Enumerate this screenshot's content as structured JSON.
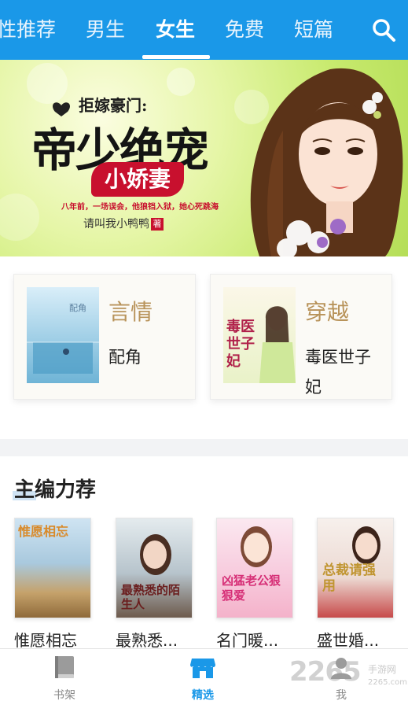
{
  "top_tabs": [
    {
      "label": "性推荐"
    },
    {
      "label": "男生"
    },
    {
      "label": "女生"
    },
    {
      "label": "免费"
    },
    {
      "label": "短篇"
    }
  ],
  "active_tab": "女生",
  "banner": {
    "subtitle": "拒嫁豪门:",
    "title": "帝少绝宠",
    "badge": "小娇妻",
    "tagline": "八年前，一场误会，他狼铛入狱，她心死跳海",
    "author": "请叫我小鸭鸭",
    "author_seal": "著"
  },
  "categories": [
    {
      "category": "言情",
      "book": "配角",
      "cover_text": "配角"
    },
    {
      "category": "穿越",
      "book": "毒医世子妃",
      "cover_text": "毒医世子妃"
    }
  ],
  "picks": {
    "heading": "主编力荐",
    "books": [
      {
        "name": "惟愿相忘",
        "cover_text": "惟愿相忘"
      },
      {
        "name": "最熟悉...",
        "cover_text": "最熟悉的陌生人"
      },
      {
        "name": "名门暖...",
        "cover_text": "凶猛老公狠狠爱"
      },
      {
        "name": "盛世婚...",
        "cover_text": "总裁请强用"
      }
    ]
  },
  "bottom_nav": [
    {
      "label": "书架",
      "icon": "book-icon"
    },
    {
      "label": "精选",
      "icon": "store-icon"
    },
    {
      "label": "我",
      "icon": "user-icon"
    }
  ],
  "watermark": {
    "number": "2265",
    "site": "手游网",
    "url": "2265.com"
  },
  "colors": {
    "accent": "#1a98e8",
    "category_gold": "#b8935a",
    "badge_red": "#c8102e"
  }
}
